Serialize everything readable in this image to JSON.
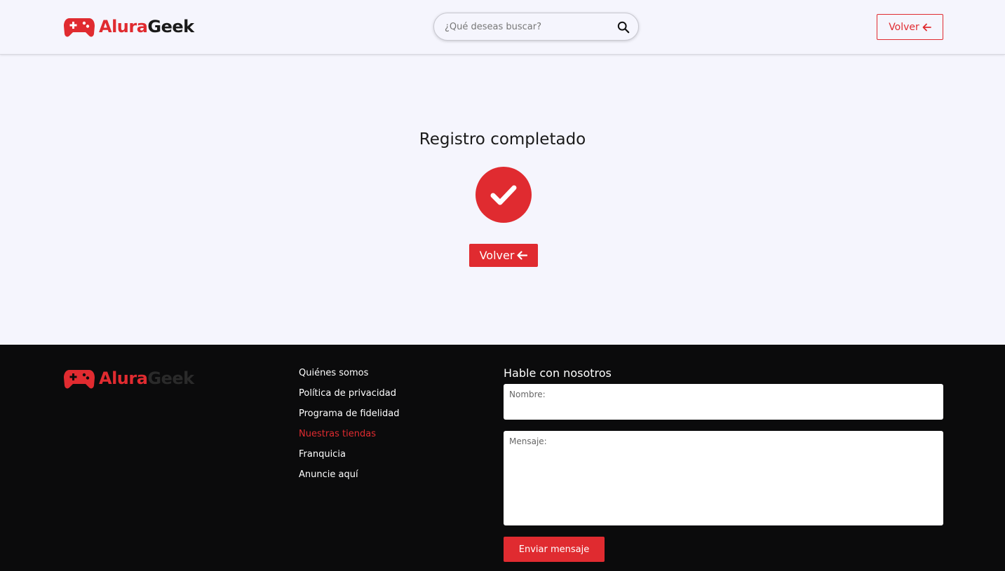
{
  "header": {
    "logo": {
      "part1": "Alura",
      "part2": "Geek",
      "icon": "gamepad-icon"
    },
    "search": {
      "placeholder": "¿Qué deseas buscar?",
      "icon": "search-icon"
    },
    "back_button": {
      "label": "Volver",
      "icon": "arrow-left-icon"
    }
  },
  "main": {
    "title": "Registro completado",
    "status_icon": "check-circle-icon",
    "back_button": {
      "label": "Volver",
      "icon": "arrow-left-icon"
    }
  },
  "footer": {
    "logo": {
      "part1": "Alura",
      "part2": "Geek",
      "icon": "gamepad-icon"
    },
    "links": [
      {
        "label": "Quiénes somos",
        "active": false
      },
      {
        "label": "Política de privacidad",
        "active": false
      },
      {
        "label": "Programa de fidelidad",
        "active": false
      },
      {
        "label": "Nuestras tiendas",
        "active": true
      },
      {
        "label": "Franquicia",
        "active": false
      },
      {
        "label": "Anuncie aquí",
        "active": false
      }
    ],
    "contact": {
      "title": "Hable con nosotros",
      "name_label": "Nombre:",
      "message_label": "Mensaje:",
      "send_button": "Enviar mensaje"
    }
  },
  "colors": {
    "accent": "#e02b30",
    "background": "#f5f5fd",
    "footer_bg": "#0b0b0c"
  }
}
